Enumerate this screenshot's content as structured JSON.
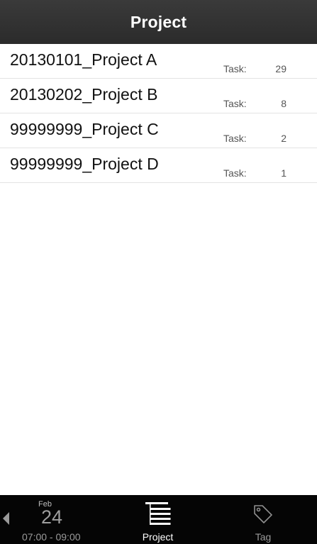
{
  "navbar": {
    "title": "Project"
  },
  "projects": [
    {
      "name": "20130101_Project A",
      "task_label": "Task:",
      "task_count": "29"
    },
    {
      "name": "20130202_Project B",
      "task_label": "Task:",
      "task_count": "8"
    },
    {
      "name": "99999999_Project C",
      "task_label": "Task:",
      "task_count": "2"
    },
    {
      "name": "99999999_Project D",
      "task_label": "Task:",
      "task_count": "1"
    }
  ],
  "tabbar": {
    "date": {
      "month": "Feb",
      "day": "24",
      "time_range": "07:00 - 09:00"
    },
    "tabs": [
      {
        "label": "Project",
        "icon": "project-tree-icon",
        "selected": true
      },
      {
        "label": "Tag",
        "icon": "tag-icon",
        "selected": false
      }
    ]
  },
  "colors": {
    "navbar_bg": "#2f2f2f",
    "tabbar_bg": "#050505",
    "selected_tab": "#ffffff",
    "unselected_tab": "#9a9a9a"
  }
}
